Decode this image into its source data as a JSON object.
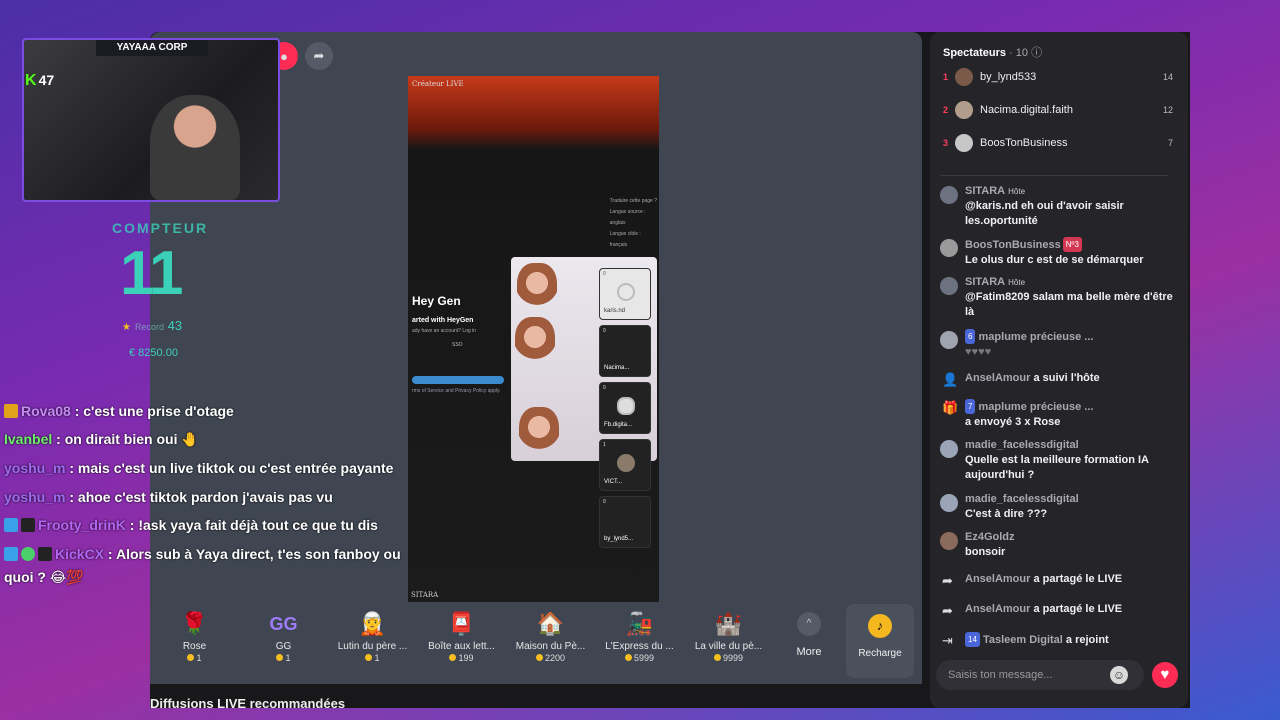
{
  "overlay": {
    "cam_title": "YAYAAA CORP",
    "kick_count": "47",
    "counter_title": "COMPTEUR",
    "counter_value": "11",
    "record_label": "Record",
    "record_value": "43",
    "money": "€ 8250.00"
  },
  "twitch_chat": [
    {
      "user": "Rova08",
      "text": ": c'est une prise d'otage"
    },
    {
      "user": "Ivanbel",
      "text": ": on dirait bien oui"
    },
    {
      "user": "yoshu_m",
      "text": ": mais c'est un live tiktok ou c'est entrée payante"
    },
    {
      "user": "yoshu_m",
      "text": ": ahoe c'est tiktok pardon j'avais pas vu"
    },
    {
      "user": "Frooty_drinK",
      "text": ": !ask yaya fait déjà tout ce que tu dis"
    },
    {
      "user": "KickCX",
      "text": ": Alors sub à Yaya direct, t'es son fanboy ou"
    },
    {
      "user": "",
      "text": "quoi ?"
    }
  ],
  "video": {
    "top_label": "Créateur LIVE",
    "bottom_label": "SITARA",
    "menu_items": [
      "Traduire cette page ?",
      "Langue source :",
      "anglais",
      "Langue cible :",
      "français"
    ],
    "heygen_logo": "Hey Gen",
    "heygen_tagline": "arted with HeyGen",
    "heygen_sub": "ady have an account? Log in",
    "heygen_sso": "SSO",
    "heygen_terms": "rms of Service and Privacy Policy apply.",
    "guests": [
      {
        "count": "0",
        "name": "karis.nd"
      },
      {
        "count": "0",
        "name": "Nacima..."
      },
      {
        "count": "0",
        "name": "Fb.digita..."
      },
      {
        "count": "1",
        "name": "VICT..."
      },
      {
        "count": "0",
        "name": "by_lynd5..."
      }
    ]
  },
  "gifts": [
    {
      "icon": "🌹",
      "name": "Rose",
      "price": "1"
    },
    {
      "icon": "GG",
      "name": "GG",
      "price": "1"
    },
    {
      "icon": "🧝",
      "name": "Lutin du père ...",
      "price": "1"
    },
    {
      "icon": "📮",
      "name": "Boîte aux lett...",
      "price": "199"
    },
    {
      "icon": "🏠",
      "name": "Maison du Pè...",
      "price": "2200"
    },
    {
      "icon": "🚂",
      "name": "L'Express du ...",
      "price": "5999"
    },
    {
      "icon": "🏰",
      "name": "La ville du pè...",
      "price": "9999"
    }
  ],
  "more_label": "More",
  "recharge_label": "Recharge",
  "recommended_label": "Diffusions LIVE recommandées",
  "panel": {
    "viewers_title": "Spectateurs",
    "viewers_count": "· 10",
    "viewers": [
      {
        "rank": "1",
        "name": "by_lynd533",
        "score": "14"
      },
      {
        "rank": "2",
        "name": "Nacima.digital.faith",
        "score": "12"
      },
      {
        "rank": "3",
        "name": "BoosTonBusiness",
        "score": "7"
      }
    ],
    "messages": [
      {
        "user": "SITARA",
        "tag": "Hôte",
        "text": "@karis.nd eh oui d'avoir saisir les.oportunité"
      },
      {
        "user": "BoosTonBusiness",
        "tag": "Nº3",
        "text": "Le olus dur c est de se démarquer"
      },
      {
        "user": "SITARA",
        "tag": "Hôte",
        "text": "@Fatim8209 salam ma belle mère d'être là"
      },
      {
        "user": "maplume précieuse ...",
        "tag": "6",
        "text": ""
      },
      {
        "user": "AnselAmour",
        "tag": "",
        "text": "a suivi l'hôte"
      },
      {
        "user": "maplume précieuse ...",
        "tag": "7",
        "text": "a envoyé 3 x Rose"
      },
      {
        "user": "madie_facelessdigital",
        "tag": "",
        "text": "Quelle est la meilleure formation IA aujourd'hui ?"
      },
      {
        "user": "madie_facelessdigital",
        "tag": "",
        "text": "C'est à dire ???"
      },
      {
        "user": "Ez4Goldz",
        "tag": "",
        "text": "bonsoir"
      },
      {
        "user": "AnselAmour",
        "tag": "",
        "text": "a partagé le LIVE"
      },
      {
        "user": "AnselAmour",
        "tag": "",
        "text": "a partagé le LIVE"
      },
      {
        "user": "Tasleem Digital",
        "tag": "14",
        "text": "a rejoint"
      }
    ],
    "input_placeholder": "Saisis ton message..."
  }
}
